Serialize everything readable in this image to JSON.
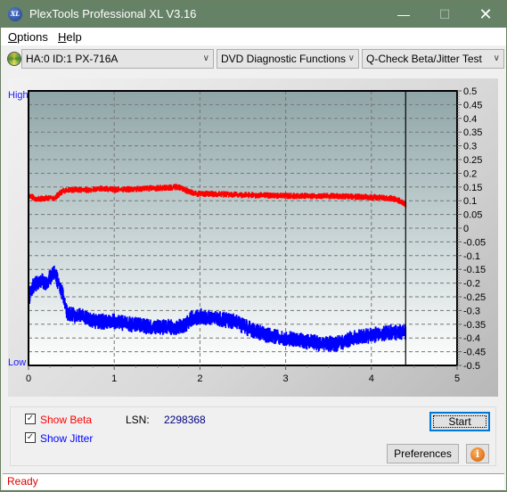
{
  "window": {
    "title": "PlexTools Professional XL V3.16",
    "app_icon": "XL",
    "controls": [
      "minimize",
      "maximize",
      "close"
    ]
  },
  "menu": {
    "items": [
      {
        "label": "Options",
        "accel": "O"
      },
      {
        "label": "Help",
        "accel": "H"
      }
    ]
  },
  "toolbar": {
    "drive_icon": "disc-icon",
    "drive_select": "HA:0 ID:1  PX-716A",
    "function_select": "DVD Diagnostic Functions",
    "test_select": "Q-Check Beta/Jitter Test"
  },
  "chart_data": {
    "type": "line",
    "title": "",
    "xlabel": "",
    "ylabel_left_high": "High",
    "ylabel_left_low": "Low",
    "xlim": [
      0,
      5
    ],
    "ylim": [
      -0.5,
      0.5
    ],
    "x_ticks": [
      "0",
      "1",
      "2",
      "3",
      "4",
      "5"
    ],
    "y_ticks_right": [
      "0.5",
      "0.45",
      "0.4",
      "0.35",
      "0.3",
      "0.25",
      "0.2",
      "0.15",
      "0.1",
      "0.05",
      "0",
      "-0.05",
      "-0.1",
      "-0.15",
      "-0.2",
      "-0.25",
      "-0.3",
      "-0.35",
      "-0.4",
      "-0.45",
      "-0.5"
    ],
    "grid": true,
    "cursor_x": 4.4,
    "series": [
      {
        "name": "Beta",
        "color": "#ff0000",
        "x": [
          0,
          0.1,
          0.2,
          0.3,
          0.4,
          0.5,
          0.7,
          0.9,
          1.0,
          1.2,
          1.4,
          1.6,
          1.75,
          1.85,
          1.95,
          2.1,
          2.3,
          2.6,
          3.0,
          3.4,
          3.8,
          4.0,
          4.2,
          4.3,
          4.4
        ],
        "values": [
          0.12,
          0.105,
          0.11,
          0.11,
          0.135,
          0.14,
          0.14,
          0.145,
          0.14,
          0.142,
          0.145,
          0.147,
          0.15,
          0.135,
          0.125,
          0.125,
          0.123,
          0.12,
          0.118,
          0.117,
          0.115,
          0.113,
          0.11,
          0.105,
          0.085
        ]
      },
      {
        "name": "Jitter",
        "color": "#0000ff",
        "x": [
          0,
          0.05,
          0.1,
          0.15,
          0.2,
          0.25,
          0.3,
          0.35,
          0.4,
          0.45,
          0.6,
          0.8,
          1.0,
          1.2,
          1.4,
          1.6,
          1.8,
          1.9,
          2.0,
          2.2,
          2.4,
          2.6,
          2.8,
          3.0,
          3.2,
          3.4,
          3.6,
          3.8,
          4.0,
          4.2,
          4.4
        ],
        "values": [
          -0.26,
          -0.21,
          -0.2,
          -0.19,
          -0.2,
          -0.18,
          -0.16,
          -0.2,
          -0.24,
          -0.31,
          -0.32,
          -0.34,
          -0.34,
          -0.35,
          -0.36,
          -0.36,
          -0.36,
          -0.33,
          -0.32,
          -0.33,
          -0.34,
          -0.37,
          -0.39,
          -0.4,
          -0.41,
          -0.42,
          -0.42,
          -0.4,
          -0.39,
          -0.38,
          -0.38
        ]
      }
    ]
  },
  "options": {
    "show_beta": {
      "label": "Show Beta",
      "checked": true,
      "color": "#ff0000"
    },
    "show_jitter": {
      "label": "Show Jitter",
      "checked": true,
      "color": "#0000ff"
    },
    "lsn_label": "LSN:",
    "lsn_value": "2298368"
  },
  "buttons": {
    "start": "Start",
    "preferences": "Preferences",
    "info_icon": "i"
  },
  "status": {
    "text": "Ready"
  }
}
